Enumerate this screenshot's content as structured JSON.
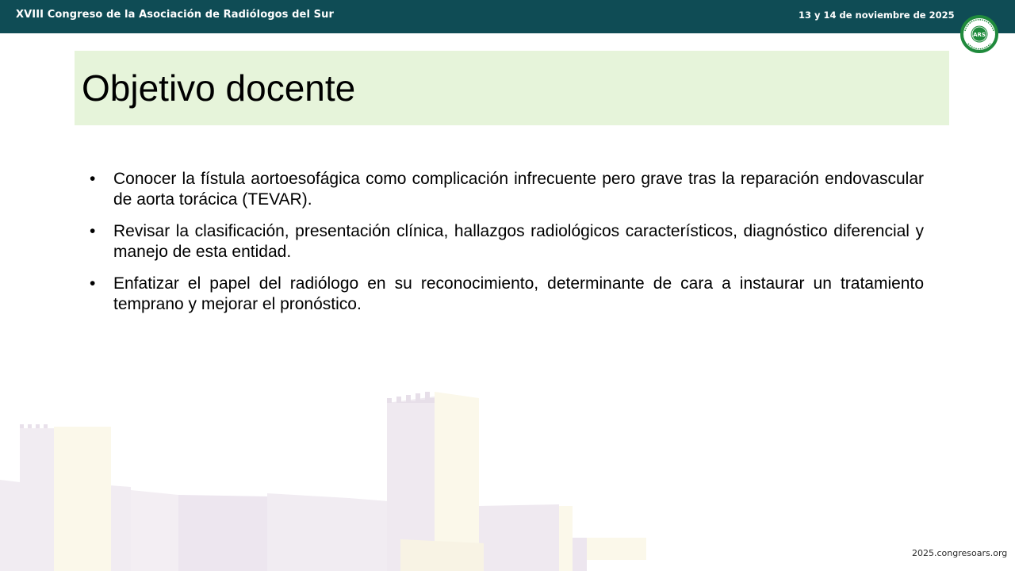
{
  "header": {
    "conference_title": "XVIII Congreso de la Asociación de Radiólogos del Sur",
    "dates": "13 y 14 de noviembre de 2025",
    "logo_text": "ARS",
    "logo_ring_text": "ASOCIACIÓN RADIÓLOGOS SUR"
  },
  "slide": {
    "title": "Objetivo docente",
    "bullet_symbol": "•",
    "bullets": [
      "Conocer la fístula aortoesofágica como complicación infrecuente pero grave tras la reparación endovascular de aorta torácica (TEVAR).",
      "Revisar la clasificación, presentación clínica, hallazgos radiológicos característicos, diagnóstico diferencial y manejo de esta entidad.",
      "Enfatizar el papel del radiólogo en su reconocimiento, determinante de cara a instaurar un tratamiento temprano y mejorar el pronóstico."
    ]
  },
  "footer": {
    "url": "2025.congresoars.org"
  },
  "colors": {
    "header_bg": "#0f4c55",
    "title_bg": "#e6f4da",
    "logo_green": "#1f8a3c",
    "skyline_purple": "#f1ecf2",
    "skyline_cream": "#fbf8ea"
  },
  "icons": {
    "logo": "ars-association-logo"
  }
}
